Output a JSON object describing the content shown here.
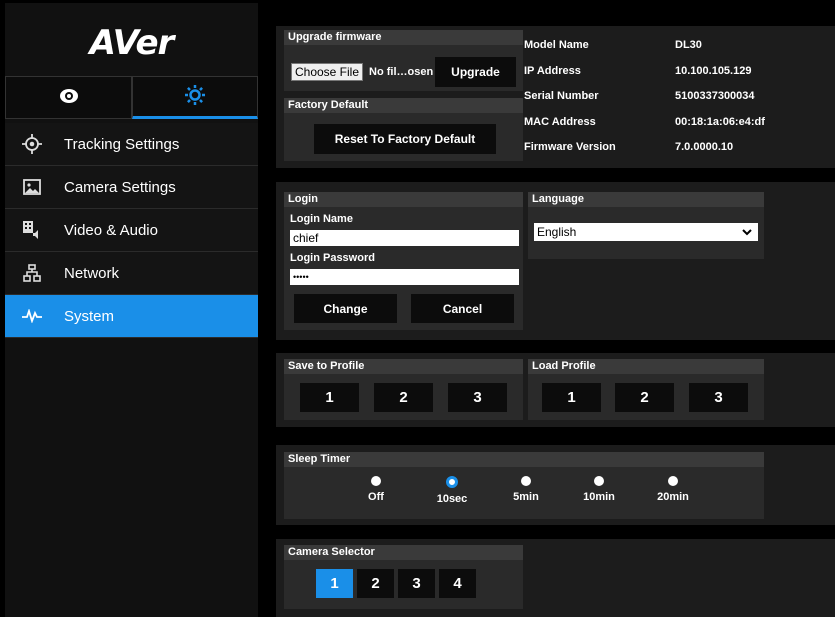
{
  "brand": {
    "logo": "AVer"
  },
  "mode_tabs": {
    "view_icon": "eye-icon",
    "settings_icon": "gear-icon"
  },
  "sidebar": {
    "items": [
      {
        "label": "Tracking Settings",
        "icon": "crosshair-icon"
      },
      {
        "label": "Camera Settings",
        "icon": "image-icon"
      },
      {
        "label": "Video & Audio",
        "icon": "video-audio-icon"
      },
      {
        "label": "Network",
        "icon": "network-icon"
      },
      {
        "label": "System",
        "icon": "pulse-icon"
      }
    ]
  },
  "firmware": {
    "header": "Upgrade firmware",
    "choose_file": "Choose File",
    "no_file": "No fil…osen",
    "upgrade": "Upgrade"
  },
  "factory": {
    "header": "Factory Default",
    "reset": "Reset To Factory Default"
  },
  "info": [
    {
      "label": "Model Name",
      "value": "DL30"
    },
    {
      "label": "IP Address",
      "value": "10.100.105.129"
    },
    {
      "label": "Serial Number",
      "value": "5100337300034"
    },
    {
      "label": "MAC Address",
      "value": "00:18:1a:06:e4:df"
    },
    {
      "label": "Firmware Version",
      "value": "7.0.0000.10"
    }
  ],
  "login": {
    "header": "Login",
    "name_label": "Login Name",
    "name_value": "chief",
    "password_label": "Login Password",
    "password_value": "•••••",
    "change": "Change",
    "cancel": "Cancel"
  },
  "language": {
    "header": "Language",
    "selected": "English"
  },
  "profiles": {
    "save_header": "Save to Profile",
    "load_header": "Load Profile",
    "buttons": [
      "1",
      "2",
      "3"
    ]
  },
  "sleep_timer": {
    "header": "Sleep Timer",
    "options": [
      "Off",
      "10sec",
      "5min",
      "10min",
      "20min"
    ],
    "selected": "10sec"
  },
  "camera_selector": {
    "header": "Camera Selector",
    "buttons": [
      "1",
      "2",
      "3",
      "4"
    ],
    "selected": "1"
  },
  "colors": {
    "accent": "#1a8fe8",
    "panel": "#1c1c1c",
    "header": "#3a3a3a"
  }
}
